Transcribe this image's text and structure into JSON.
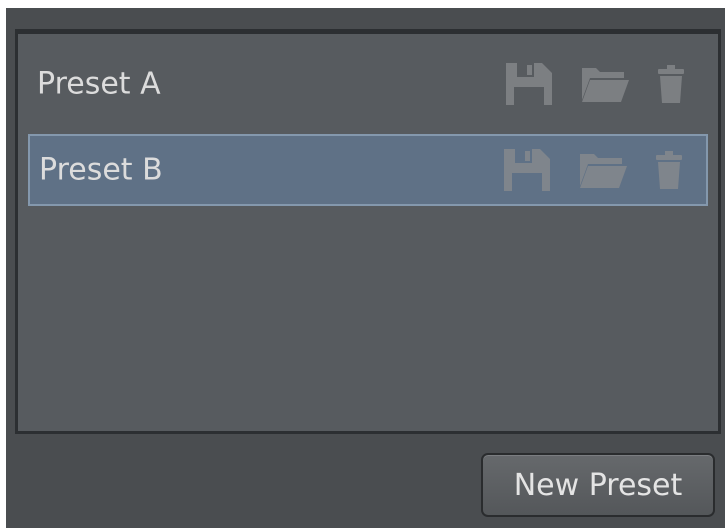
{
  "presets": [
    {
      "label": "Preset A",
      "selected": false,
      "icons": [
        "save-icon",
        "folder-open-icon",
        "trash-icon"
      ]
    },
    {
      "label": "Preset B",
      "selected": true,
      "icons": [
        "save-icon",
        "folder-open-icon",
        "trash-icon"
      ]
    }
  ],
  "actions": {
    "new_preset_label": "New Preset"
  },
  "colors": {
    "panel_bg": "#4a4d50",
    "list_bg": "#575b5f",
    "selected_bg": "#5f7186",
    "selected_border": "#8498ad",
    "icon_color": "#7c7f82",
    "text_color": "#dcdcdc"
  }
}
